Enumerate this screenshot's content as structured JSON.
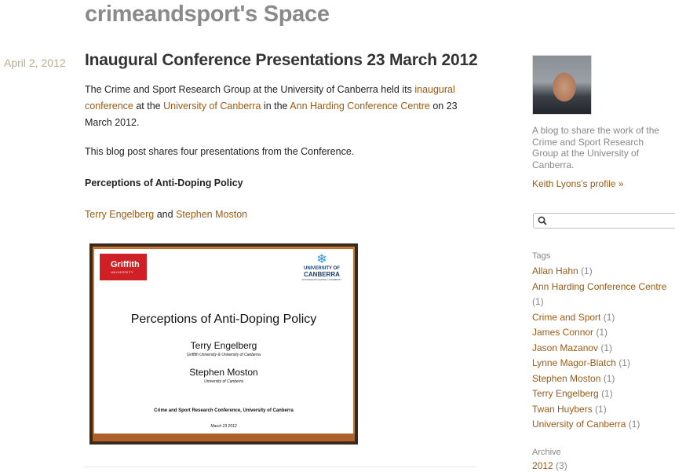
{
  "blog": {
    "title": "crimeandsport's Space"
  },
  "post": {
    "date": "April 2, 2012",
    "title": "Inaugural Conference Presentations 23 March 2012",
    "p1": {
      "t1": "The Crime and Sport Research Group at the University of Canberra held its ",
      "link1": "inaugural conference",
      "t2": " at the ",
      "link2": "University of Canberra",
      "t3": " in the ",
      "link3": "Ann Harding Conference Centre",
      "t4": " on 23 March 2012."
    },
    "p2": "This blog post shares four presentations from the Conference.",
    "subheading": "Perceptions of Anti-Doping Policy",
    "authors": {
      "a1": "Terry Engelberg",
      "and": " and ",
      "a2": "Stephen Moston"
    },
    "slide": {
      "griffith": "Griffith",
      "griffith_sub": "UNIVERSITY",
      "uc_line1": "UNIVERSITY OF",
      "uc_line2": "CANBERRA",
      "uc_line3": "AUSTRALIA'S CAPITAL UNIVERSITY",
      "title": "Perceptions of Anti-Doping Policy",
      "name1": "Terry Engelberg",
      "aff1": "Griffith University & University of Canberra",
      "name2": "Stephen Moston",
      "aff2": "University of Canberra",
      "conference": "Crime and Sport Research Conference, University of Canberra",
      "date": "March 23 2012"
    }
  },
  "sidebar": {
    "profile_description": "A blog to share the work of the Crime and Sport Research Group at the University of Canberra.",
    "profile_link": "Keith Lyons's profile »",
    "search_placeholder": "",
    "tags_heading": "Tags",
    "tags": [
      {
        "name": "Allan Hahn",
        "count": "(1)"
      },
      {
        "name": "Ann Harding Conference Centre",
        "count": "(1)"
      },
      {
        "name": "Crime and Sport",
        "count": "(1)"
      },
      {
        "name": "James Connor",
        "count": "(1)"
      },
      {
        "name": "Jason Mazanov",
        "count": "(1)"
      },
      {
        "name": "Lynne Magor-Blatch",
        "count": "(1)"
      },
      {
        "name": "Stephen Moston",
        "count": "(1)"
      },
      {
        "name": "Terry Engelberg",
        "count": "(1)"
      },
      {
        "name": "Twan Huybers",
        "count": "(1)"
      },
      {
        "name": "University of Canberra",
        "count": "(1)"
      }
    ],
    "archive_heading": "Archive",
    "archive": {
      "year": "2012",
      "count": "(3)"
    }
  },
  "colors": {
    "link": "#9a5b16",
    "muted": "#888888",
    "date": "#b8ac8a"
  }
}
